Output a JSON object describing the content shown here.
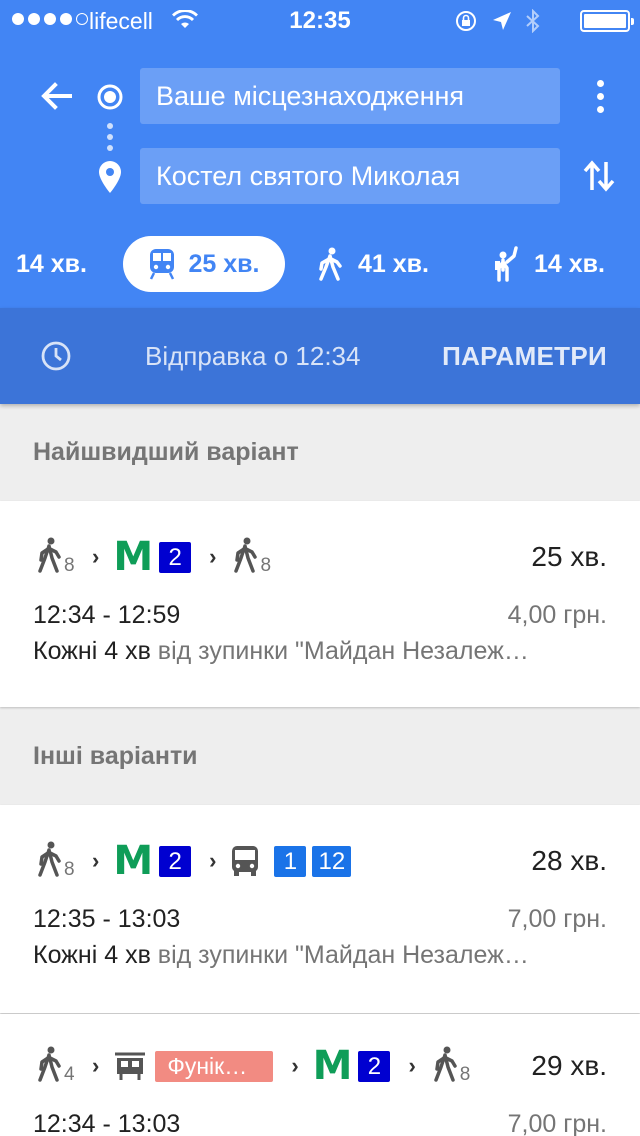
{
  "status_bar": {
    "carrier": "lifecell",
    "time": "12:35",
    "signal_bars_filled": 4,
    "signal_bars_total": 5
  },
  "search": {
    "origin": "Ваше місцезнаходження",
    "destination": "Костел святого Миколая"
  },
  "modes": {
    "car": "14 хв.",
    "transit": "25 хв.",
    "walk": "41 хв.",
    "ride": "14 хв."
  },
  "depart": {
    "text": "Відправка о 12:34",
    "params_label": "ПАРАМЕТРИ"
  },
  "sections": {
    "fastest": "Найшвидший варіант",
    "others": "Інші варіанти"
  },
  "routes": [
    {
      "walk_start": "8",
      "metro_line": "2",
      "walk_end": "8",
      "duration": "25 хв.",
      "times": "12:34 - 12:59",
      "price": "4,00 грн.",
      "freq_main": "Кожні 4 хв",
      "freq_detail": " від зупинки \"Майдан Незалеж…"
    },
    {
      "walk_start": "8",
      "metro_line": "2",
      "bus_1": "1",
      "bus_2": "12",
      "duration": "28 хв.",
      "times": "12:35 - 13:03",
      "price": "7,00 грн.",
      "freq_main": "Кожні 4 хв",
      "freq_detail": " від зупинки \"Майдан Незалеж…"
    },
    {
      "walk_start": "4",
      "funicular": "Фунік…",
      "metro_line": "2",
      "walk_end": "8",
      "duration": "29 хв.",
      "times": "12:34 - 13:03",
      "price": "7,00 грн."
    }
  ],
  "colors": {
    "header": "#4285f4",
    "depart_bar": "#3c74d8",
    "metro_green": "#0f9d58",
    "metro_line_blue": "#0000d0",
    "bus_blue": "#1a73e8",
    "funicular_red": "#f28b82"
  },
  "icons": [
    "back-arrow-icon",
    "origin-dot-icon",
    "destination-pin-icon",
    "more-vert-icon",
    "swap-icon",
    "car-icon",
    "train-icon",
    "walk-icon",
    "ride-hail-icon",
    "clock-icon",
    "metro-icon",
    "bus-icon",
    "funicular-icon"
  ]
}
